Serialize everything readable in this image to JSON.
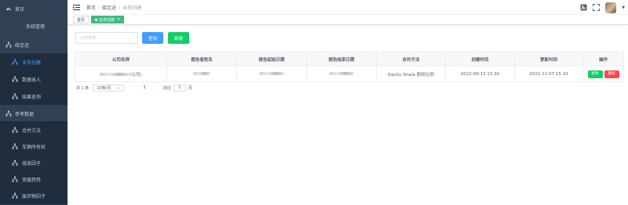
{
  "sidebar": {
    "bg_color": "#304156",
    "active_color": "#409eff",
    "items": [
      {
        "label": "首页",
        "icon": "dashboard-icon"
      },
      {
        "label": "系统管理",
        "icon": "none"
      },
      {
        "label": "碳足迹",
        "icon": "tree-icon"
      },
      {
        "label": "业务创建",
        "icon": "tree-icon"
      },
      {
        "label": "数据录入",
        "icon": "tree-icon"
      },
      {
        "label": "结果查询",
        "icon": "tree-icon"
      },
      {
        "label": "参考数据",
        "icon": "tree-icon"
      },
      {
        "label": "合并方法",
        "icon": "tree-icon"
      },
      {
        "label": "车辆所有权",
        "icon": "tree-icon"
      },
      {
        "label": "排放因子",
        "icon": "tree-icon"
      },
      {
        "label": "变暖趋势",
        "icon": "tree-icon"
      },
      {
        "label": "废弃物因子",
        "icon": "tree-icon"
      }
    ]
  },
  "breadcrumb": [
    "首页",
    "碳足迹",
    "业务创建"
  ],
  "tags": [
    {
      "label": "首页",
      "active": false
    },
    {
      "label": "业务创建",
      "active": true
    }
  ],
  "search": {
    "placeholder": "公司名称",
    "query_label": "查询",
    "add_label": "新增"
  },
  "table": {
    "columns": [
      "公司名称",
      "报告者姓名",
      "报告起始日期",
      "报告结束日期",
      "合并方法",
      "创建时间",
      "更新时间",
      "操作"
    ],
    "rows": [
      {
        "company": "(公司)",
        "reporter": "",
        "start_date": "",
        "end_date": "",
        "method": "Equity Share 股权比例",
        "created": "2022-09-13 13:30",
        "updated": "2022-11-07 15:33",
        "edit_label": "修改",
        "delete_label": "删除"
      }
    ]
  },
  "pagination": {
    "total": "共 1 条",
    "page_size": "10条/页",
    "current_page": "1",
    "goto_label": "前往",
    "goto_value": "1",
    "page_suffix": "页"
  },
  "colors": {
    "primary": "#409eff",
    "success": "#13ce66",
    "danger": "#ff4949",
    "tag_active": "#42b983"
  }
}
